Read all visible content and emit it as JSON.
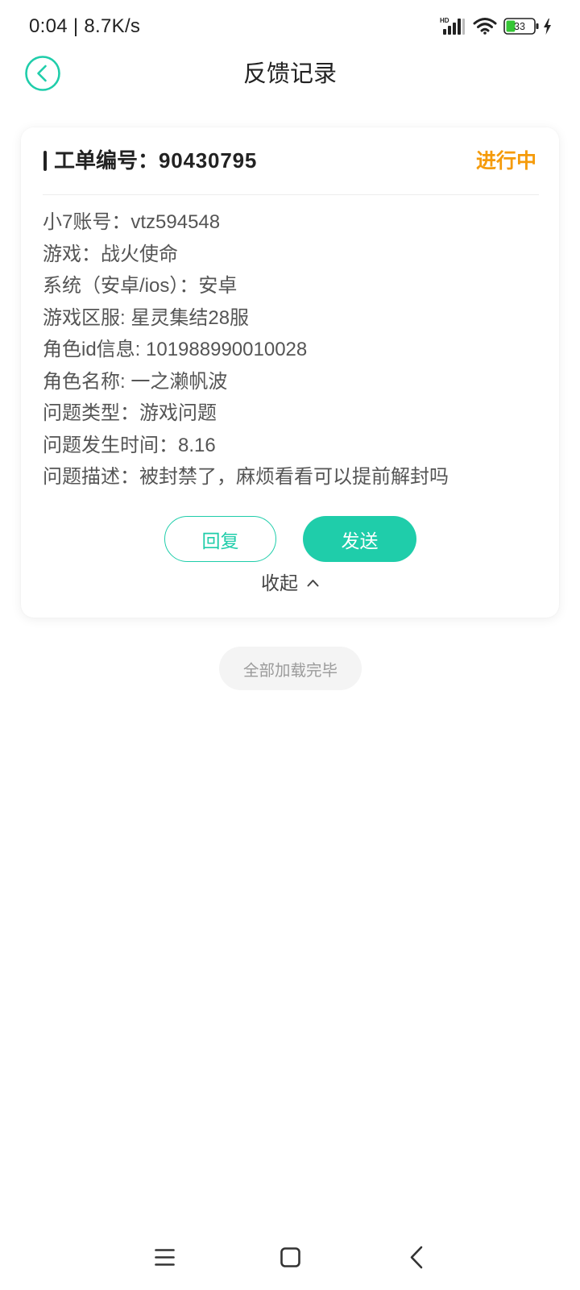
{
  "status_bar": {
    "time_speed": "0:04 | 8.7K/s",
    "network_label": "HD",
    "battery_level": "33",
    "icons": [
      "signal-hd-icon",
      "wifi-icon",
      "battery-icon",
      "charging-icon"
    ]
  },
  "header": {
    "title": "反馈记录",
    "back_icon": "chevron-left-circle-icon"
  },
  "ticket": {
    "number_label": "工单编号：",
    "number": "90430795",
    "status": "进行中",
    "fields": [
      {
        "label": "小7账号：",
        "value": "vtz594548"
      },
      {
        "label": "游戏：",
        "value": "战火使命"
      },
      {
        "label": "系统（安卓/ios）：",
        "value": "安卓"
      },
      {
        "label": "游戏区服: ",
        "value": "星灵集结28服"
      },
      {
        "label": "角色id信息: ",
        "value": "101988990010028"
      },
      {
        "label": "角色名称: ",
        "value": "一之濑帆波"
      },
      {
        "label": "问题类型：",
        "value": "游戏问题"
      },
      {
        "label": "问题发生时间：",
        "value": "8.16"
      },
      {
        "label": "问题描述：",
        "value": "被封禁了，麻烦看看可以提前解封吗"
      }
    ],
    "reply_label": "回复",
    "send_label": "发送",
    "collapse_label": "收起",
    "collapse_icon": "chevron-up-icon"
  },
  "footer": {
    "end_of_list": "全部加载完毕"
  },
  "nav_bar": {
    "icons": [
      "menu-icon",
      "home-icon",
      "back-icon"
    ]
  },
  "colors": {
    "accent": "#1fcdaa",
    "status_in_progress": "#f59b0a",
    "battery": "#35c635"
  }
}
